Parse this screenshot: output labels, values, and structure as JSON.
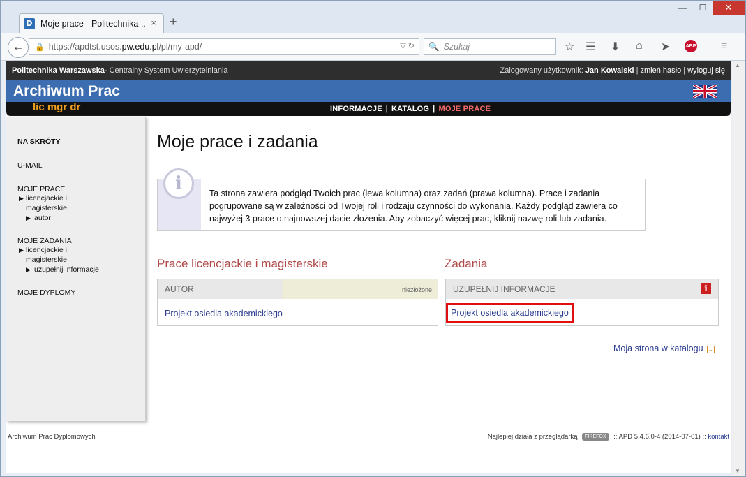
{
  "browser": {
    "tab_title": "Moje prace - Politechnika ...",
    "tab_favicon": "D",
    "tab_close": "×",
    "new_tab": "+",
    "win_min": "—",
    "win_max": "☐",
    "win_close": "✕",
    "url_prefix": "https://apdtst.usos.",
    "url_host": "pw.edu.pl",
    "url_path": "/pl/my-apd/",
    "search_placeholder": "Szukaj",
    "abp_label": "ABP"
  },
  "site": {
    "org": "Politechnika Warszawska",
    "system": " - Centralny System Uwierzytelniania",
    "logged_label": "Zalogowany użytkownik: ",
    "user": "Jan Kowalski",
    "change_password": "zmień hasło",
    "logout": "wyloguj się",
    "app_title": "Archiwum Prac",
    "subtitle": "lic mgr dr",
    "menu": [
      "INFORMACJE",
      "KATALOG",
      "MOJE PRACE"
    ],
    "menu_sep": "|"
  },
  "sidebar": {
    "shortcuts": "NA SKRÓTY",
    "umail": "U-MAIL",
    "my_works": "MOJE PRACE",
    "my_works_items": [
      "licencjackie i",
      "magisterskie"
    ],
    "my_works_sub": "autor",
    "my_tasks": "MOJE ZADANIA",
    "my_tasks_items": [
      "licencjackie i",
      "magisterskie"
    ],
    "my_tasks_sub": "uzupełnij informacje",
    "diplomas": "MOJE DYPLOMY"
  },
  "main": {
    "title": "Moje prace i zadania",
    "info_icon": "i",
    "info_text": "Ta strona zawiera podgląd Twoich prac (lewa kolumna) oraz zadań (prawa kolumna). Prace i zadania pogrupowane są w zależności od Twojej roli i rodzaju czynności do wykonania. Każdy podgląd zawiera co najwyżej 3 prace o najnowszej dacie złożenia. Aby zobaczyć więcej prac, kliknij nazwę roli lub zadania.",
    "left_title": "Prace licencjackie i magisterskie",
    "left_role": "AUTOR",
    "left_status": "niezłożone",
    "left_work": "Projekt osiedla akademickiego",
    "right_title": "Zadania",
    "right_role": "UZUPEŁNIJ INFORMACJE",
    "right_badge": "i",
    "right_work": "Projekt osiedla akademickiego",
    "catalog_link": "Moja strona w katalogu",
    "catalog_icon": "→"
  },
  "footer": {
    "left": "Archiwum Prac Dyplomowych",
    "best_with": "Najlepiej działa z przeglądarką",
    "firefox": "FIREFOX",
    "version": " :: APD 5.4.6.0-4 (2014-07-01) :: ",
    "contact": "kontakt"
  }
}
